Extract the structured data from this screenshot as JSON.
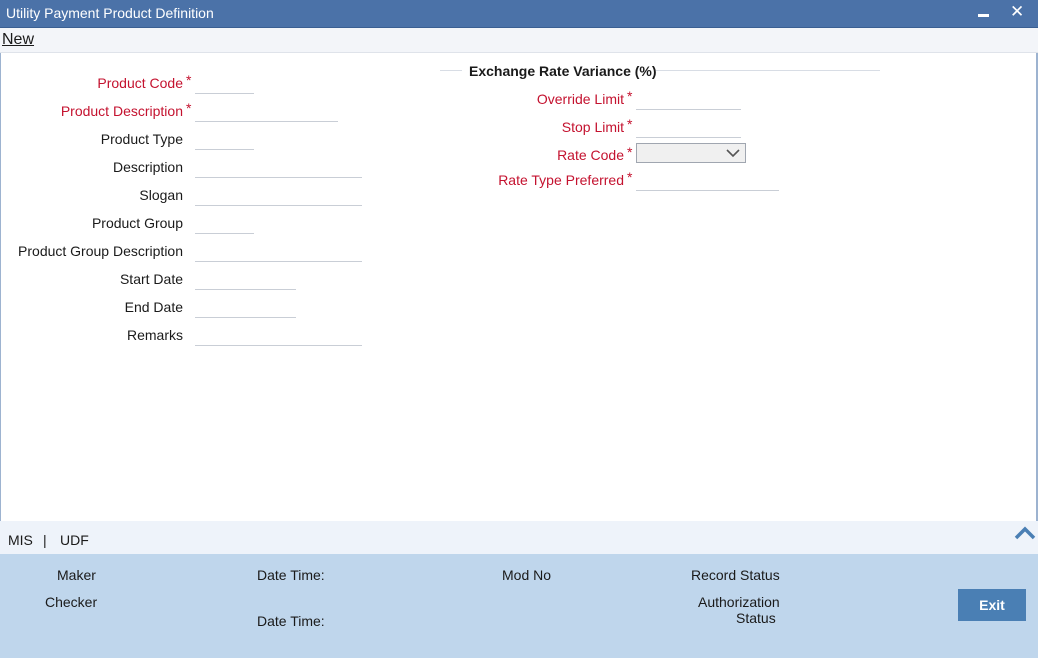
{
  "window": {
    "title": "Utility Payment Product Definition"
  },
  "toolbar": {
    "new_label": "New"
  },
  "form": {
    "product_code": {
      "label": "Product Code",
      "required": "*",
      "value": ""
    },
    "product_description": {
      "label": "Product Description",
      "required": "*",
      "value": ""
    },
    "product_type": {
      "label": "Product Type",
      "value": ""
    },
    "description": {
      "label": "Description",
      "value": ""
    },
    "slogan": {
      "label": "Slogan",
      "value": ""
    },
    "product_group": {
      "label": "Product Group",
      "value": ""
    },
    "product_group_description": {
      "label": "Product Group Description",
      "value": ""
    },
    "start_date": {
      "label": "Start Date",
      "value": ""
    },
    "end_date": {
      "label": "End Date",
      "value": ""
    },
    "remarks": {
      "label": "Remarks",
      "value": ""
    }
  },
  "exchange": {
    "title": "Exchange Rate Variance (%)",
    "override_limit": {
      "label": "Override Limit",
      "required": "*",
      "value": ""
    },
    "stop_limit": {
      "label": "Stop Limit",
      "required": "*",
      "value": ""
    },
    "rate_code": {
      "label": "Rate Code",
      "required": "*",
      "value": ""
    },
    "rate_type_preferred": {
      "label": "Rate Type Preferred",
      "required": "*",
      "value": ""
    }
  },
  "tabs": {
    "mis": "MIS",
    "separator": "|",
    "udf": "UDF"
  },
  "footer": {
    "maker": "Maker",
    "checker": "Checker",
    "date_time_1": "Date Time:",
    "date_time_2": "Date Time:",
    "mod_no": "Mod No",
    "record_status": "Record Status",
    "authorization_line1": "Authorization",
    "authorization_line2": "Status",
    "exit_label": "Exit"
  },
  "colors": {
    "title_bar": "#4b72a8",
    "required": "#c4122f",
    "footer_bg": "#bfd6ec",
    "exit_button": "#4a7fb4"
  },
  "icons": {
    "minimize": "minimize-icon",
    "close": "close-icon",
    "dropdown": "chevron-down-icon",
    "collapse": "chevron-up-icon"
  }
}
